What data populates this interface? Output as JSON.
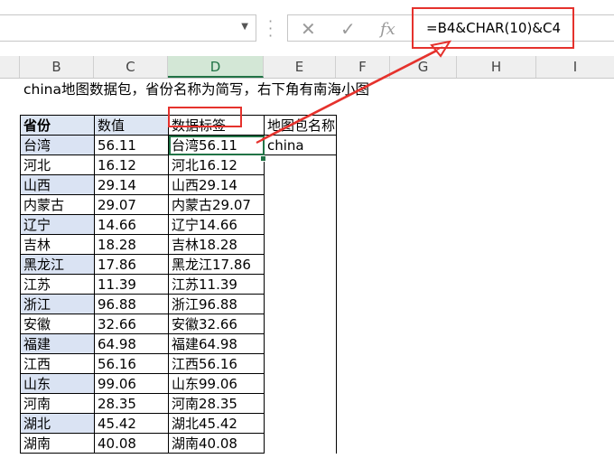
{
  "formula_bar": {
    "formula": "=B4&CHAR(10)&C4",
    "cancel_icon": "✕",
    "enter_icon": "✓",
    "fx_icon": "fx"
  },
  "column_headers": [
    "B",
    "C",
    "D",
    "E",
    "F",
    "G",
    "H",
    "I"
  ],
  "selected_column": "D",
  "title": "china地图数据包，省份名称为简写，右下角有南海小图",
  "table": {
    "headers": [
      "省份",
      "数值",
      "数据标签",
      "地图包名称"
    ],
    "map_name": "china",
    "rows": [
      {
        "province": "台湾",
        "value": "56.11",
        "label": "台湾56.11"
      },
      {
        "province": "河北",
        "value": "16.12",
        "label": "河北16.12"
      },
      {
        "province": "山西",
        "value": "29.14",
        "label": "山西29.14"
      },
      {
        "province": "内蒙古",
        "value": "29.07",
        "label": "内蒙古29.07"
      },
      {
        "province": "辽宁",
        "value": "14.66",
        "label": "辽宁14.66"
      },
      {
        "province": "吉林",
        "value": "18.28",
        "label": "吉林18.28"
      },
      {
        "province": "黑龙江",
        "value": "17.86",
        "label": "黑龙江17.86"
      },
      {
        "province": "江苏",
        "value": "11.39",
        "label": "江苏11.39"
      },
      {
        "province": "浙江",
        "value": "96.88",
        "label": "浙江96.88"
      },
      {
        "province": "安徽",
        "value": "32.66",
        "label": "安徽32.66"
      },
      {
        "province": "福建",
        "value": "64.98",
        "label": "福建64.98"
      },
      {
        "province": "江西",
        "value": "56.16",
        "label": "江西56.16"
      },
      {
        "province": "山东",
        "value": "99.06",
        "label": "山东99.06"
      },
      {
        "province": "河南",
        "value": "28.35",
        "label": "河南28.35"
      },
      {
        "province": "湖北",
        "value": "45.42",
        "label": "湖北45.42"
      },
      {
        "province": "湖南",
        "value": "40.08",
        "label": "湖南40.08"
      }
    ]
  },
  "colors": {
    "accent_red": "#e5322d",
    "excel_green": "#217346",
    "header_fill": "#dde6f3"
  }
}
